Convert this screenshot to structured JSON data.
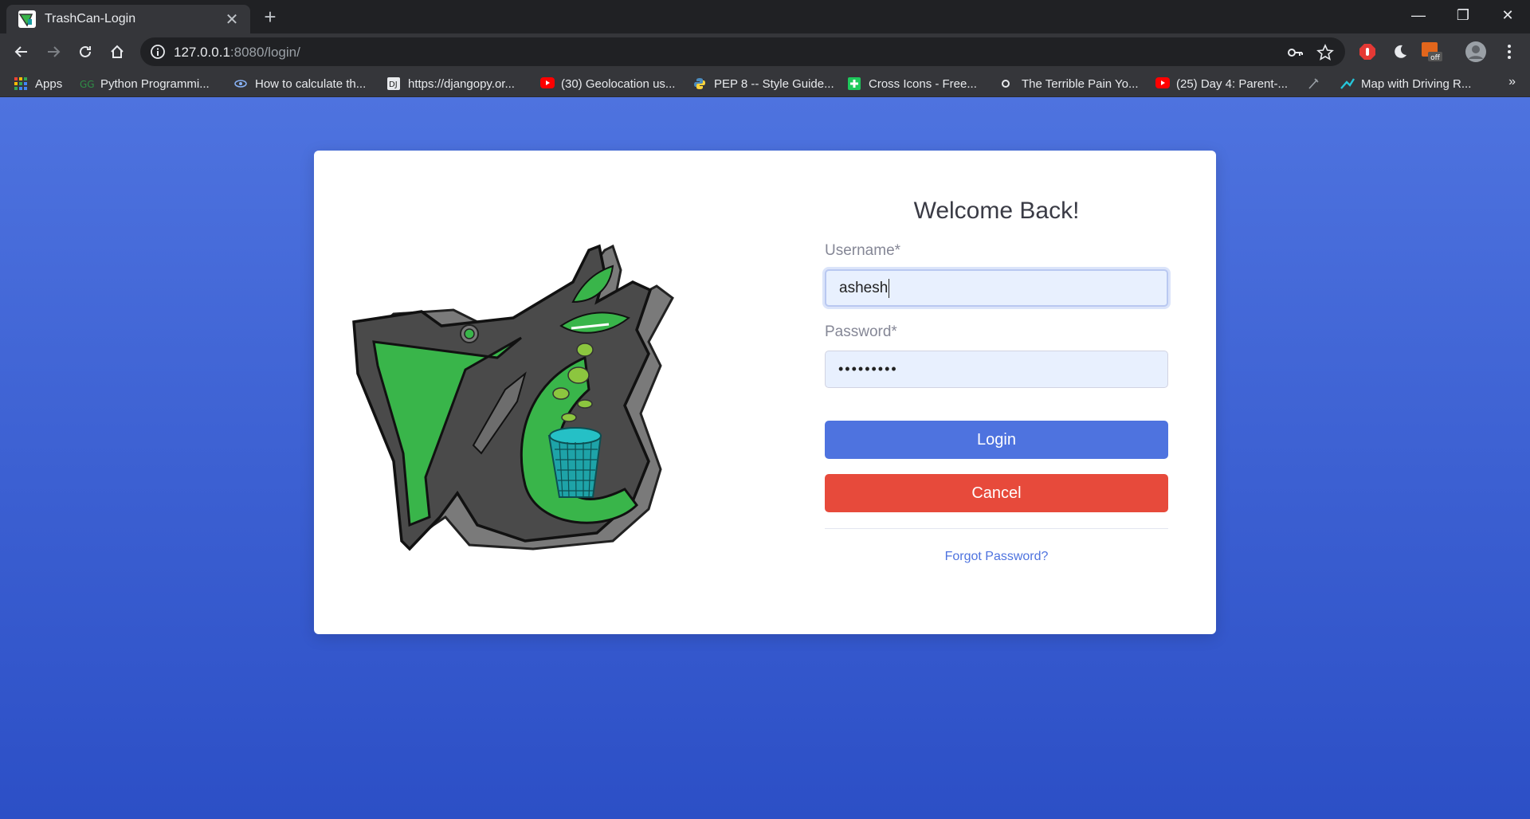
{
  "browser": {
    "tab_title": "TrashCan-Login",
    "url_host": "127.0.0.1",
    "url_rest": ":8080/login/",
    "bookmarks": [
      "Apps",
      "Python Programmi...",
      "How to calculate th...",
      "https://djangopy.or...",
      "(30) Geolocation us...",
      "PEP 8 -- Style Guide...",
      "Cross Icons - Free...",
      "The Terrible Pain Yo...",
      "(25) Day 4: Parent-...",
      "Map with Driving R..."
    ],
    "bookmarks_more": "»",
    "extension_badge": "off"
  },
  "login": {
    "title": "Welcome Back!",
    "username_label": "Username*",
    "username_value": "ashesh",
    "password_label": "Password*",
    "password_value": "•••••••••",
    "login_button": "Login",
    "cancel_button": "Cancel",
    "forgot_link": "Forgot Password?"
  },
  "colors": {
    "primary": "#4e73df",
    "danger": "#e74a3b",
    "logo_green": "#39b54a",
    "logo_dark": "#4a4a4a"
  }
}
